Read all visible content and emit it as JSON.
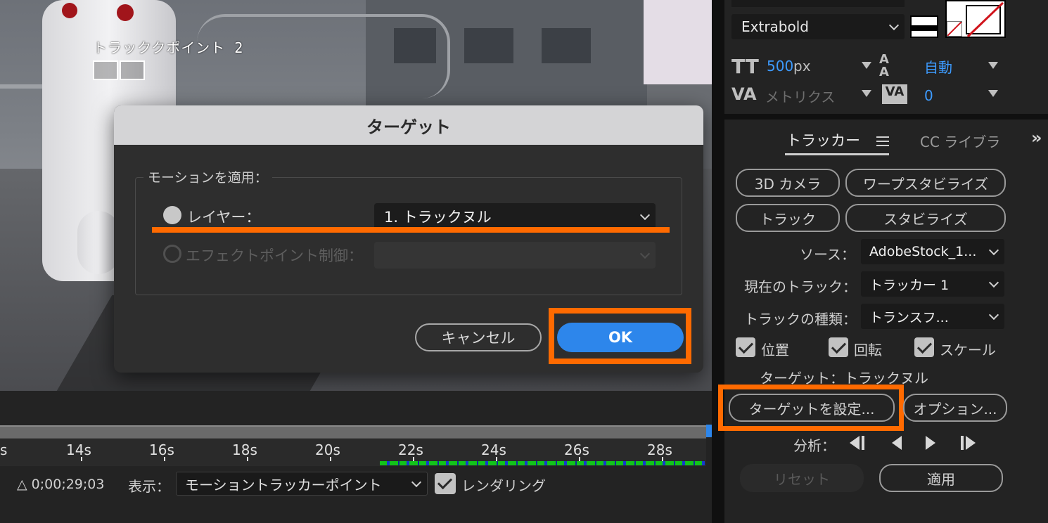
{
  "viewer": {
    "track_point_label": "トラッククポイント 2"
  },
  "dialog": {
    "title": "ターゲット",
    "group_label": "モーションを適用：",
    "layer_label": "レイヤー：",
    "layer_value": "1. トラックヌル",
    "effect_label": "エフェクトポイント制御：",
    "cancel_label": "キャンセル",
    "ok_label": "OK"
  },
  "timeline": {
    "ticks": [
      "s",
      "14s",
      "16s",
      "18s",
      "20s",
      "22s",
      "24s",
      "26s",
      "28s"
    ],
    "timecode": "△ 0;00;29;03",
    "show_label": "表示：",
    "show_value": "モーショントラッカーポイント",
    "render_label": "レンダリング"
  },
  "character": {
    "font_style": "Extrabold",
    "font_size_value": "500",
    "font_size_unit": "px",
    "leading_value": "自動",
    "kerning_value": "メトリクス",
    "tracking_value": "0"
  },
  "tracker": {
    "tab_label": "トラッカー",
    "tab_cc": "CC ライブラ",
    "btn_3d_camera": "3D カメラ",
    "btn_warp_stabilize": "ワープスタビライズ",
    "btn_track": "トラック",
    "btn_stabilize": "スタビライズ",
    "source_label": "ソース：",
    "source_value": "AdobeStock_1...",
    "current_track_label": "現在のトラック：",
    "current_track_value": "トラッカー 1",
    "track_type_label": "トラックの種類：",
    "track_type_value": "トランスフ...",
    "position_label": "位置",
    "rotation_label": "回転",
    "scale_label": "スケール",
    "target_text": "ターゲット：トラックヌル",
    "set_target_label": "ターゲットを設定...",
    "options_label": "オプション...",
    "analyze_label": "分析：",
    "reset_label": "リセット",
    "apply_label": "適用"
  },
  "colors": {
    "accent": "#2d86eb",
    "highlight": "#ff6a00",
    "track_green": "#12c41a"
  }
}
